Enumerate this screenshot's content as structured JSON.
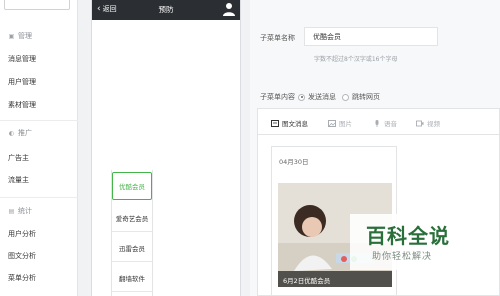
{
  "sidebar": {
    "sections": [
      {
        "title": "管理",
        "items": [
          "消息管理",
          "用户管理",
          "素材管理"
        ]
      },
      {
        "title": "推广",
        "items": [
          "广告主",
          "流量主"
        ]
      },
      {
        "title": "统计",
        "items": [
          "用户分析",
          "图文分析",
          "菜单分析"
        ]
      }
    ]
  },
  "phone": {
    "back_label": "返回",
    "title": "预防",
    "menu_items": [
      "优酷会员",
      "爱奇艺会员",
      "迅雷会员",
      "翻墙软件"
    ]
  },
  "editor": {
    "name_label": "子菜单名称",
    "name_value": "优酷会员",
    "name_hint": "字数不超过8个汉字或16个字母",
    "content_label": "子菜单内容",
    "radio_send": "发送消息",
    "radio_link": "跳转网页",
    "tabs": [
      "图文消息",
      "图片",
      "语音",
      "视频"
    ],
    "card_date": "04月30日",
    "card_caption": "6月2日优酷会员"
  },
  "watermark": {
    "title": "百科全说",
    "subtitle": "助你轻松解决"
  },
  "colors": {
    "accent_green": "#44b549",
    "topbar": "#2b2f33"
  }
}
